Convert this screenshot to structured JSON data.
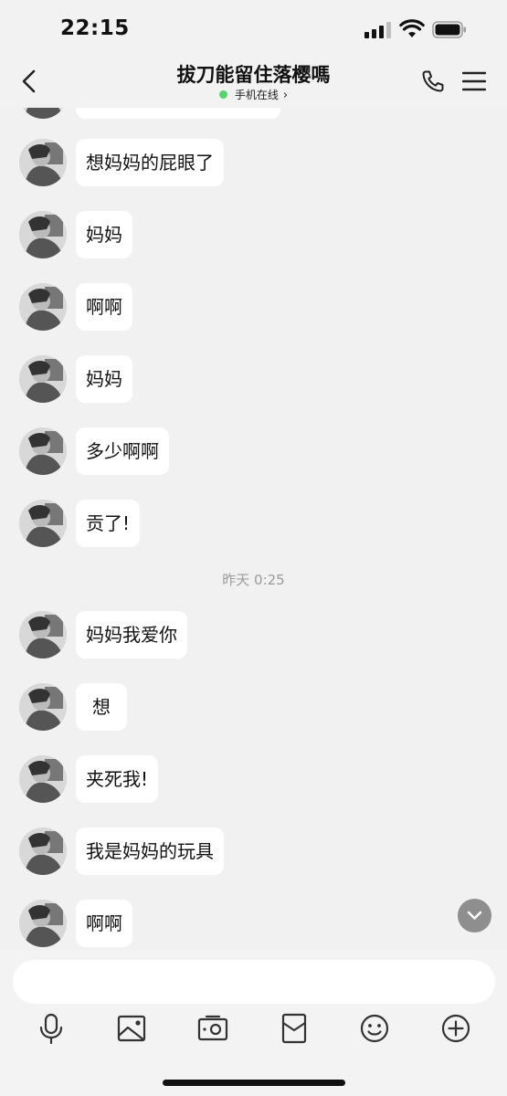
{
  "status_bar": {
    "time": "22:15"
  },
  "header": {
    "title": "拔刀能留住落樱嗎",
    "subtitle": "手机在线",
    "accent": "#4cd964"
  },
  "messages": [
    {
      "text": "想妈妈的屁眼了"
    },
    {
      "text": "妈妈"
    },
    {
      "text": "啊啊"
    },
    {
      "text": "妈妈"
    },
    {
      "text": "多少啊啊"
    },
    {
      "text": "贡了!"
    },
    {
      "text": "妈妈我爱你"
    },
    {
      "text": "想"
    },
    {
      "text": "夹死我!"
    },
    {
      "text": "我是妈妈的玩具"
    },
    {
      "text": "啊啊"
    }
  ],
  "timestamp": "昨天 0:25",
  "toolbar": [
    "microphone-icon",
    "image-icon",
    "camera-icon",
    "red-packet-icon",
    "emoji-icon",
    "plus-icon"
  ]
}
